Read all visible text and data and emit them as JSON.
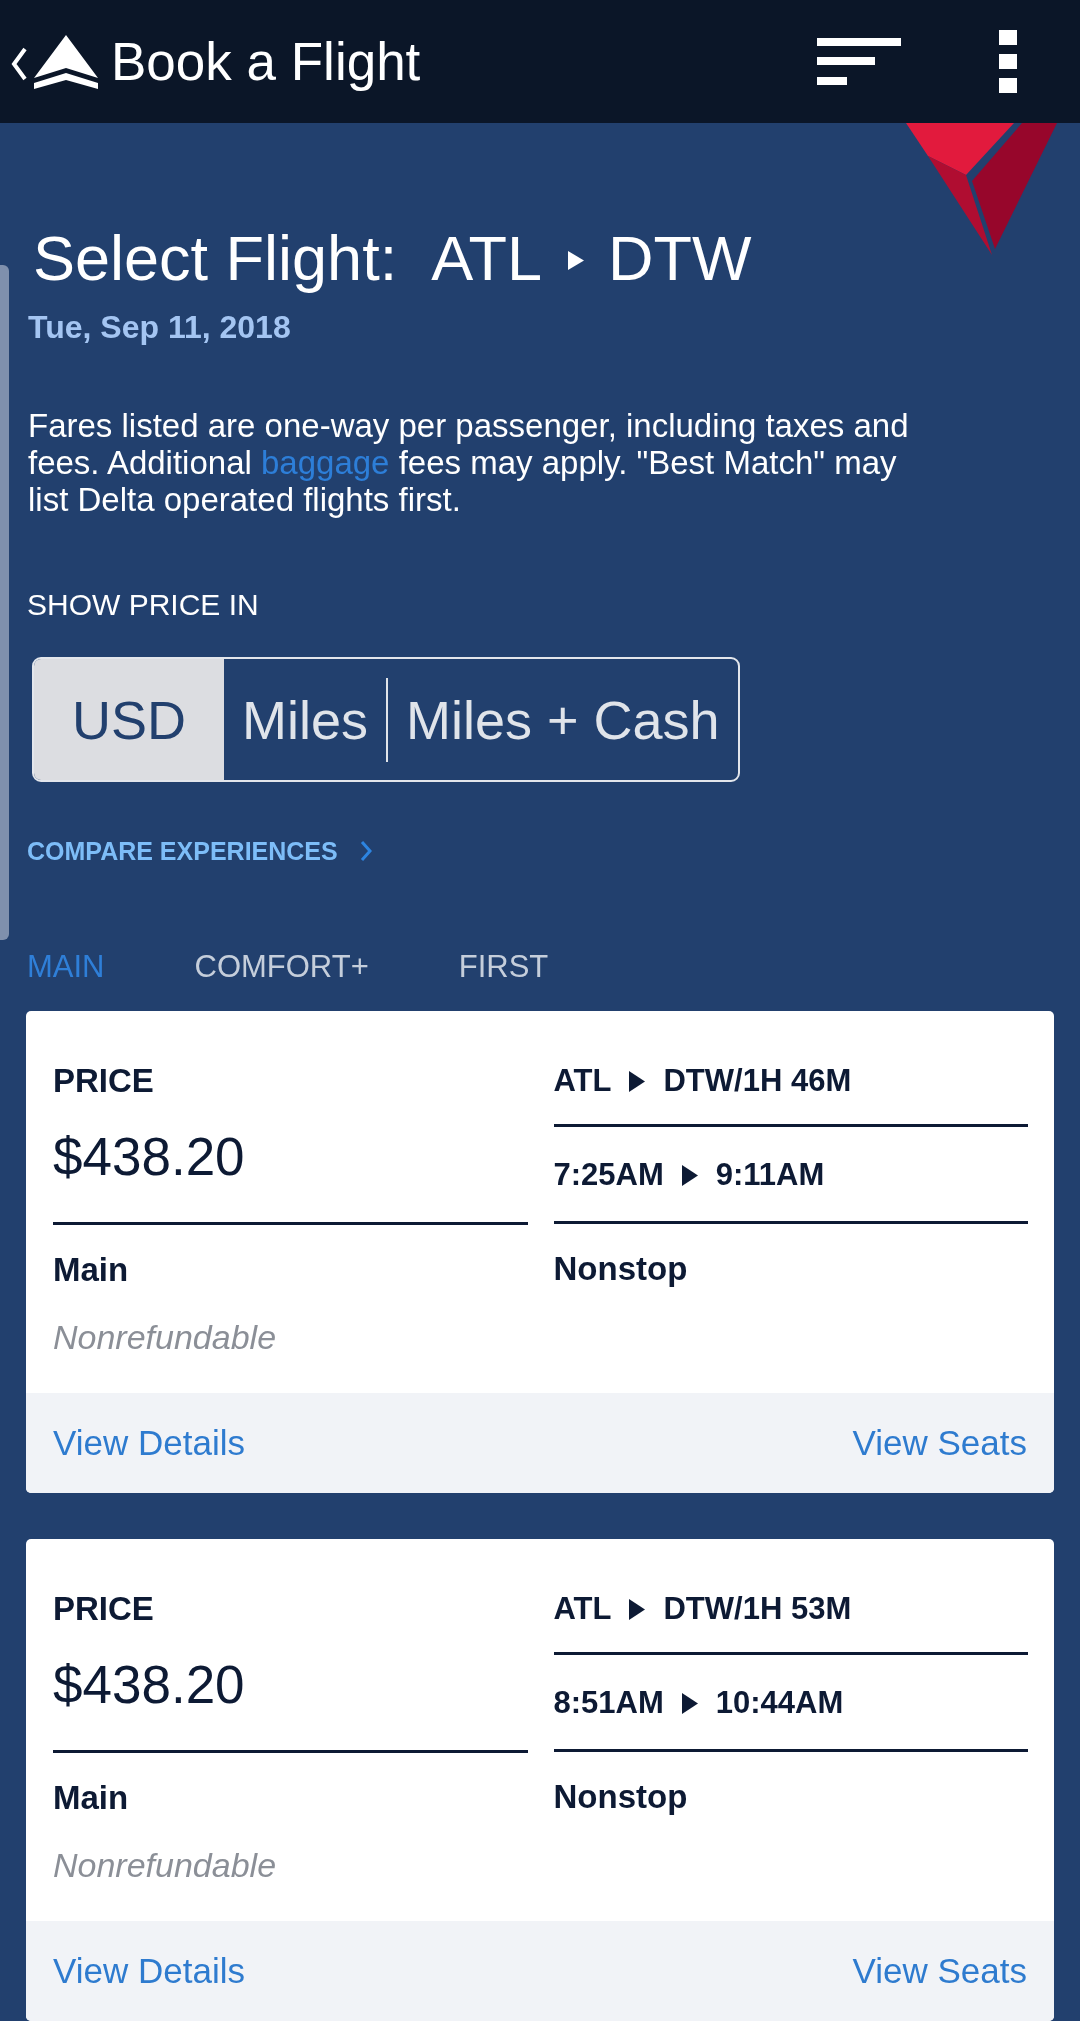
{
  "app_bar": {
    "title": "Book a Flight"
  },
  "heading": {
    "label": "Select Flight:",
    "origin": "ATL",
    "destination": "DTW"
  },
  "date": "Tue, Sep 11, 2018",
  "notice": {
    "before": "Fares listed are one-way per passenger, including taxes and fees. Additional",
    "link": "baggage",
    "after": "fees may apply. \"Best Match\" may list Delta operated flights first."
  },
  "price_display": {
    "label": "SHOW PRICE IN",
    "options": [
      {
        "label": "USD",
        "selected": true
      },
      {
        "label": "Miles",
        "selected": false
      },
      {
        "label": "Miles + Cash",
        "selected": false
      }
    ]
  },
  "compare_link": "COMPARE EXPERIENCES",
  "cabin_tabs": [
    {
      "label": "MAIN",
      "selected": true
    },
    {
      "label": "COMFORT+",
      "selected": false
    },
    {
      "label": "FIRST",
      "selected": false
    }
  ],
  "flights": [
    {
      "price_label": "PRICE",
      "price": "$438.20",
      "fare_class": "Main",
      "refund_policy": "Nonrefundable",
      "origin": "ATL",
      "destination_duration": "DTW/1H 46M",
      "departure": "7:25AM",
      "arrival": "9:11AM",
      "stops": "Nonstop",
      "actions": [
        "View Details",
        "View Seats"
      ]
    },
    {
      "price_label": "PRICE",
      "price": "$438.20",
      "fare_class": "Main",
      "refund_policy": "Nonrefundable",
      "origin": "ATL",
      "destination_duration": "DTW/1H 53M",
      "departure": "8:51AM",
      "arrival": "10:44AM",
      "stops": "Nonstop",
      "actions": [
        "View Details",
        "View Seats"
      ]
    }
  ]
}
